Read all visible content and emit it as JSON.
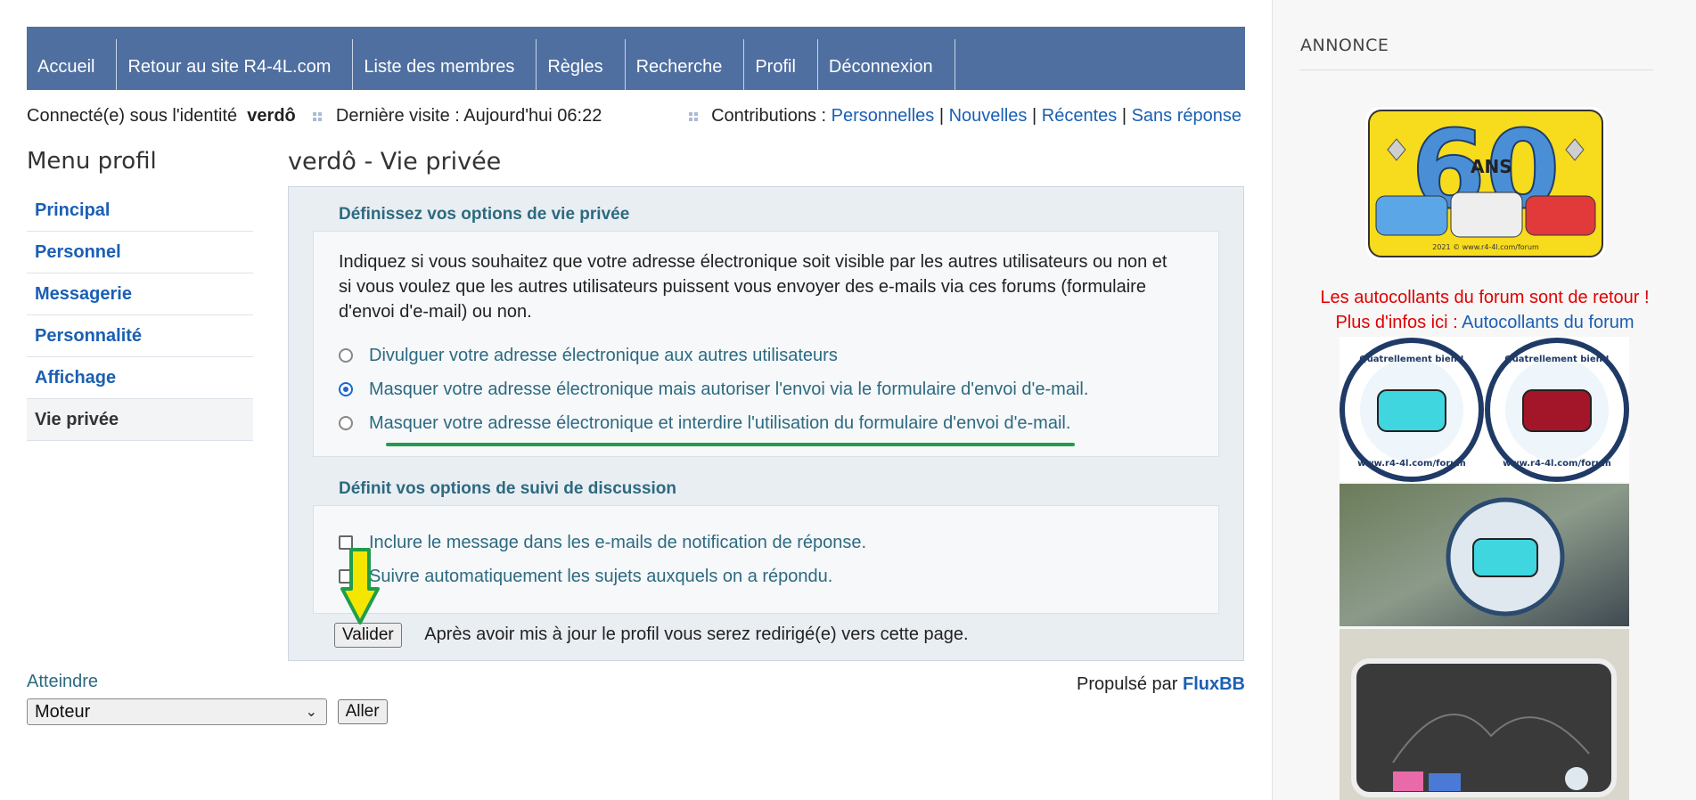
{
  "nav": {
    "items": [
      "Accueil",
      "Retour au site R4-4L.com",
      "Liste des membres",
      "Règles",
      "Recherche",
      "Profil",
      "Déconnexion"
    ]
  },
  "status": {
    "logged_prefix": "Connecté(e) sous l'identité",
    "username": "verdô",
    "last_visit": "Dernière visite : Aujourd'hui 06:22",
    "contributions_label": "Contributions :",
    "links": [
      "Personnelles",
      "Nouvelles",
      "Récentes",
      "Sans réponse"
    ],
    "separator": "|"
  },
  "menu": {
    "title": "Menu profil",
    "items": [
      "Principal",
      "Personnel",
      "Messagerie",
      "Personnalité",
      "Affichage",
      "Vie privée"
    ]
  },
  "main": {
    "title": "verdô - Vie privée",
    "privacy": {
      "legend": "Définissez vos options de vie privée",
      "intro": "Indiquez si vous souhaitez que votre adresse électronique soit visible par les autres utilisateurs ou non et si vous voulez que les autres utilisateurs puissent vous envoyer des e-mails via ces forums (formulaire d'envoi d'e-mail) ou non.",
      "options": [
        "Divulguer votre adresse électronique aux autres utilisateurs",
        "Masquer votre adresse électronique mais autoriser l'envoi via le formulaire d'envoi d'e-mail.",
        "Masquer votre adresse électronique et interdire l'utilisation du formulaire d'envoi d'e-mail."
      ],
      "selected_index": 1
    },
    "subscription": {
      "legend": "Définit vos options de suivi de discussion",
      "options": [
        "Inclure le message dans les e-mails de notification de réponse.",
        "Suivre automatiquement les sujets auxquels on a répondu."
      ]
    },
    "submit_label": "Valider",
    "submit_note": "Après avoir mis à jour le profil vous serez redirigé(e) vers cette page."
  },
  "footer": {
    "goto_label": "Atteindre",
    "goto_selected": "Moteur",
    "goto_button": "Aller",
    "powered_prefix": "Propulsé par",
    "powered_name": "FluxBB"
  },
  "sidebar": {
    "title": "ANNONCE",
    "sticker_text": "ANS",
    "sticker_number": "60",
    "sticker_url": "2021 © www.r4-4l.com/forum",
    "promo_line1": "Les autocollants du forum sont de retour !",
    "promo_prefix": "Plus d'infos ici :",
    "promo_link": "Autocollants du forum",
    "sticker_slogan": "Quatrellement bien !",
    "sticker_site": "www.r4-4l.com/forum"
  },
  "colors": {
    "nav_bg": "#4f6fa0",
    "link": "#1a5fb4",
    "legend": "#2d6a80",
    "panel_bg": "#e9eef3",
    "highlight_underline": "#1f9d4c",
    "arrow_fill": "#f5e600",
    "promo_red": "#e00000"
  }
}
